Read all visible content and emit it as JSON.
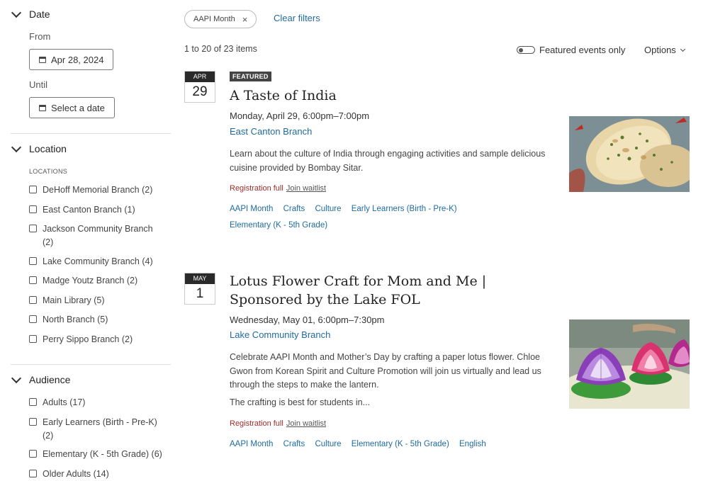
{
  "sidebar": {
    "date": {
      "heading": "Date",
      "from_label": "From",
      "from_value": "Apr 28, 2024",
      "until_label": "Until",
      "until_value": "Select a date"
    },
    "location": {
      "heading": "Location",
      "caption": "LOCATIONS",
      "items": [
        {
          "label": "DeHoff Memorial Branch (2)"
        },
        {
          "label": "East Canton Branch (1)"
        },
        {
          "label": "Jackson Community Branch (2)"
        },
        {
          "label": "Lake Community Branch (4)"
        },
        {
          "label": "Madge Youtz Branch (2)"
        },
        {
          "label": "Main Library (5)"
        },
        {
          "label": "North Branch (5)"
        },
        {
          "label": "Perry Sippo Branch (2)"
        }
      ]
    },
    "audience": {
      "heading": "Audience",
      "items": [
        {
          "label": "Adults (17)"
        },
        {
          "label": "Early Learners (Birth - Pre-K) (2)"
        },
        {
          "label": "Elementary (K - 5th Grade) (6)"
        },
        {
          "label": "Older Adults (14)"
        }
      ]
    }
  },
  "filters": {
    "chip": "AAPI Month",
    "chip_remove": "×",
    "clear": "Clear filters"
  },
  "results": {
    "count": "1 to 20 of 23 items",
    "featured_toggle": "Featured events only",
    "options": "Options"
  },
  "events": [
    {
      "month": "APR",
      "day": "29",
      "badge": "FEATURED",
      "title": "A Taste of India",
      "when": "Monday, April 29, 6:00pm–7:00pm",
      "branch": "East Canton Branch",
      "description": "Learn about the culture of India through engaging activities and sample delicious cuisine provided by Bombay Sitar.",
      "status": "Registration full",
      "waitlist": "Join waitlist",
      "tags": [
        "AAPI Month",
        "Crafts",
        "Culture",
        "Early Learners (Birth - Pre-K)",
        "Elementary (K - 5th Grade)"
      ]
    },
    {
      "month": "MAY",
      "day": "1",
      "title_line1": "Lotus Flower Craft for Mom and Me |",
      "title_line2": "Sponsored by the Lake FOL",
      "when": "Wednesday, May 01, 6:00pm–7:30pm",
      "branch": "Lake Community Branch",
      "description": "Celebrate AAPI Month and Mother’s Day by crafting a paper lotus flower. Chloe Gwon from Korean Spirit and Culture Promotion will join us virtually and lead us through the steps to make the lantern.",
      "description2": "The crafting is best for students in...",
      "status": "Registration full",
      "waitlist": "Join waitlist",
      "tags": [
        "AAPI Month",
        "Crafts",
        "Culture",
        "Elementary (K - 5th Grade)",
        "English"
      ]
    }
  ]
}
